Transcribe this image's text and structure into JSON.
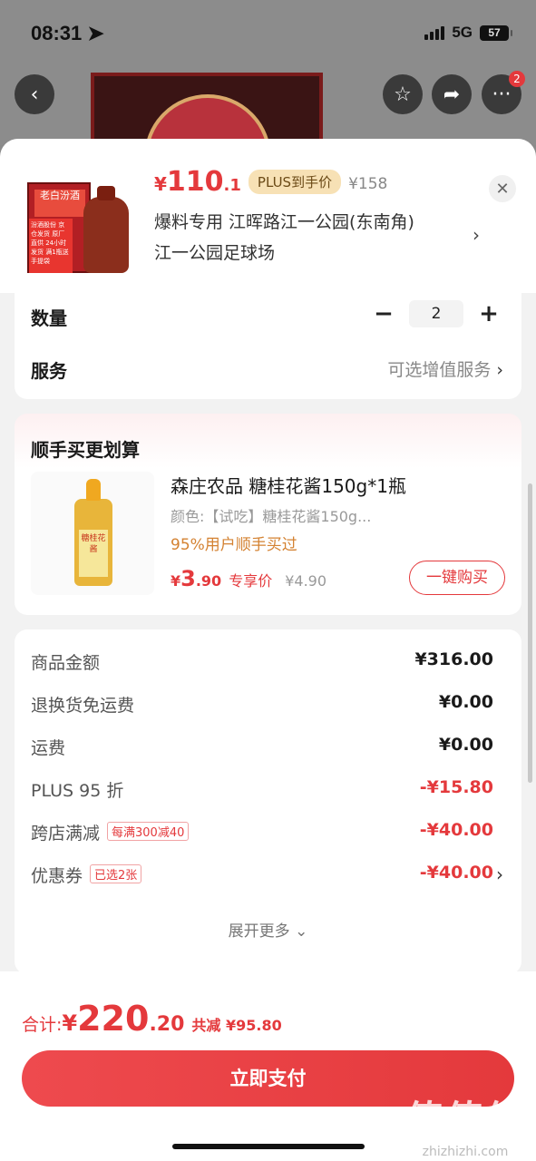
{
  "status_bar": {
    "time": "08:31",
    "network": "5G",
    "battery": "57"
  },
  "top_nav": {
    "back_icon": "chevron-left-icon",
    "badge_count": "2"
  },
  "product": {
    "price_yen": "¥",
    "price_int": "110",
    "price_dec": ".1",
    "plus_tag": "PLUS到手价",
    "original_price": "¥158",
    "address_line1": "爆料专用  江晖路江一公园(东南角)",
    "address_line2": "江一公园足球场",
    "thumb_text": "老白汾酒",
    "thumb_sticker": "汾酒股份 京仓发货 原厂直供 24小时发货 满1瓶送手提袋"
  },
  "options": {
    "quantity_label": "数量",
    "quantity_minus": "−",
    "quantity_value": "2",
    "quantity_plus": "+",
    "service_label": "服务",
    "service_value": "可选增值服务"
  },
  "addon": {
    "title": "顺手买更划算",
    "name": "森庄农品 糖桂花酱150g*1瓶",
    "spec": "颜色:【试吃】糖桂花酱150g...",
    "percent": "95%用户顺手买过",
    "price_yen": "¥",
    "price_int": "3",
    "price_dec": ".90",
    "price_tag": "专享价",
    "orig_price": "¥4.90",
    "buy_button": "一键购买",
    "bottle_label": "糖桂花酱"
  },
  "summary": {
    "rows": [
      {
        "label": "商品金额",
        "value": "¥316.00",
        "tag": ""
      },
      {
        "label": "退换货免运费",
        "value": "¥0.00",
        "tag": ""
      },
      {
        "label": "运费",
        "value": "¥0.00",
        "tag": ""
      },
      {
        "label": "PLUS 95 折",
        "value": "-¥15.80",
        "tag": ""
      },
      {
        "label": "跨店满减",
        "value": "-¥40.00",
        "tag": "每满300减40"
      },
      {
        "label": "优惠券",
        "value": "-¥40.00",
        "tag": "已选2张"
      }
    ],
    "expand": "展开更多 ⌄"
  },
  "footer": {
    "total_label": "合计:",
    "total_yen": "¥",
    "total_int": "220",
    "total_dec": ".20",
    "saved": "共减 ¥95.80",
    "pay_button": "立即支付"
  },
  "watermark": {
    "logo": "值值值",
    "url": "zhizhizhi.com"
  },
  "colors": {
    "accent": "#e4393c",
    "plus_tag_bg": "#f7e1b5",
    "orange_text": "#d48232"
  }
}
